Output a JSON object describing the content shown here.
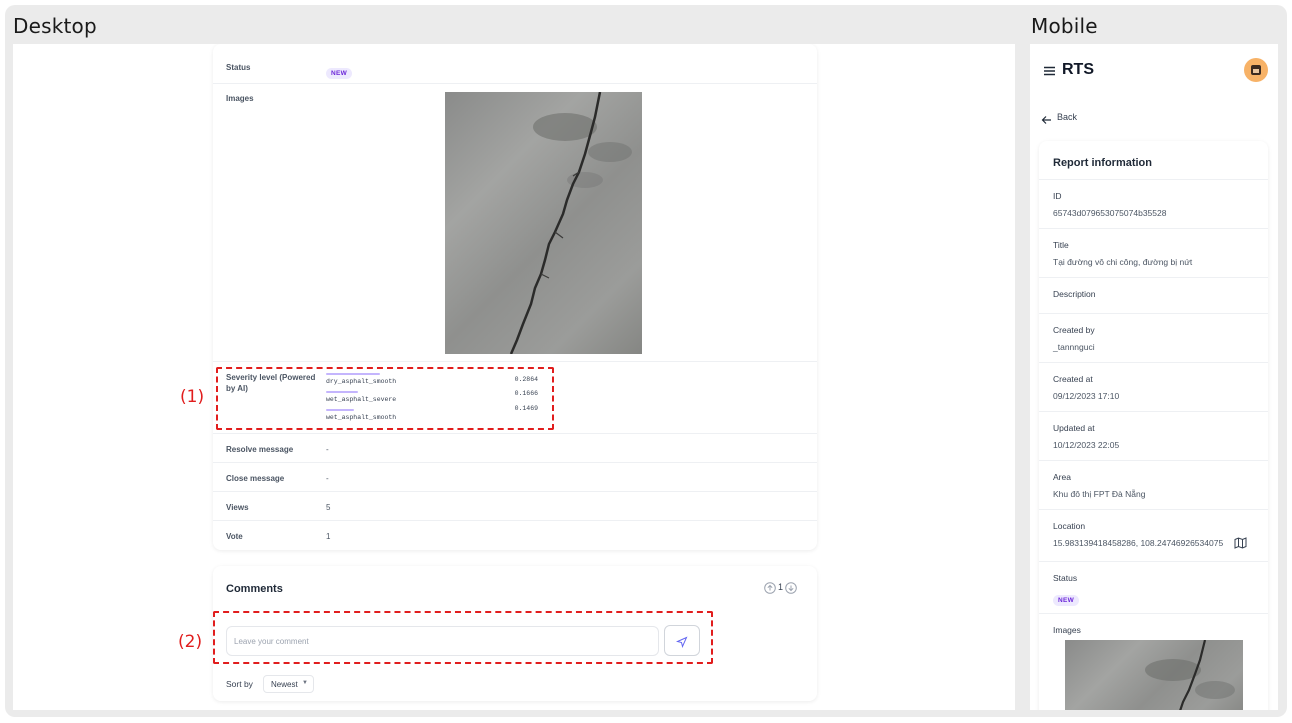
{
  "panels": {
    "desktop_title": "Desktop",
    "mobile_title": "Mobile"
  },
  "desktop": {
    "status": {
      "label": "Status",
      "badge": "NEW"
    },
    "images": {
      "label": "Images"
    },
    "severity": {
      "label": "Severity level (Powered by AI)",
      "items": [
        {
          "name": "dry_asphalt_smooth",
          "score": "0.2864",
          "fraction": 0.2864
        },
        {
          "name": "wet_asphalt_severe",
          "score": "0.1666",
          "fraction": 0.1666
        },
        {
          "name": "wet_asphalt_smooth",
          "score": "0.1469",
          "fraction": 0.1469
        }
      ]
    },
    "resolve_message": {
      "label": "Resolve message",
      "value": "-"
    },
    "close_message": {
      "label": "Close message",
      "value": "-"
    },
    "views": {
      "label": "Views",
      "value": "5"
    },
    "vote": {
      "label": "Vote",
      "value": "1"
    },
    "annotations": {
      "one": "(1)",
      "two": "(2)"
    },
    "comments": {
      "title": "Comments",
      "vote_count": "1",
      "input_placeholder": "Leave your comment",
      "sort_label": "Sort by",
      "sort_value": "Newest"
    }
  },
  "mobile": {
    "app_title": "RTS",
    "back_label": "Back",
    "card_title": "Report information",
    "fields": {
      "id": {
        "label": "ID",
        "value": "65743d079653075074b35528"
      },
      "title": {
        "label": "Title",
        "value": "Tại đường vô chi công, đường bị nứt"
      },
      "description": {
        "label": "Description"
      },
      "created_by": {
        "label": "Created by",
        "value": "_tannnguci"
      },
      "created_at": {
        "label": "Created at",
        "value": "09/12/2023 17:10"
      },
      "updated_at": {
        "label": "Updated at",
        "value": "10/12/2023 22:05"
      },
      "area": {
        "label": "Area",
        "value": "Khu đô thị FPT Đà Nẵng"
      },
      "location": {
        "label": "Location",
        "value": "15.983139418458286, 108.24746926534075"
      },
      "status": {
        "label": "Status",
        "badge": "NEW"
      },
      "images": {
        "label": "Images"
      }
    }
  },
  "colors": {
    "accent": "#6d28d9",
    "badge_bg": "#ede9fe",
    "annotation": "#e11d1d"
  }
}
